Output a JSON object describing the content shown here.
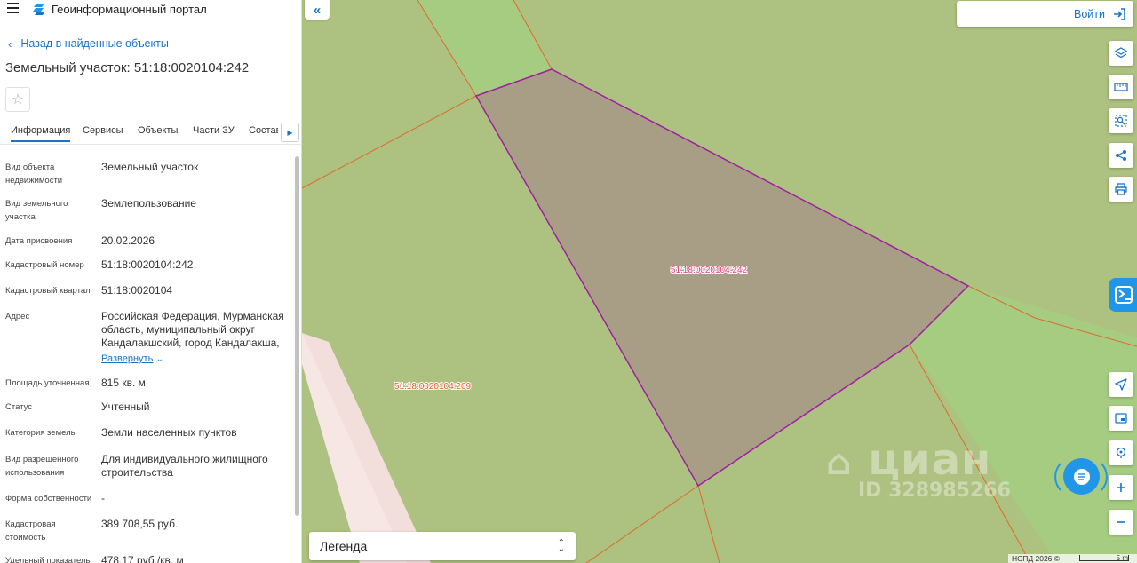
{
  "header": {
    "portal_title": "Геоинформационный портал",
    "login_label": "Войти"
  },
  "nav": {
    "back_label": "Назад в найденные объекты"
  },
  "object": {
    "title": "Земельный участок: 51:18:0020104:242"
  },
  "tabs": [
    {
      "label": "Информация",
      "active": true
    },
    {
      "label": "Сервисы"
    },
    {
      "label": "Объекты"
    },
    {
      "label": "Части ЗУ"
    },
    {
      "label": "Состав"
    }
  ],
  "properties": [
    {
      "label": "Вид объекта недвижимости",
      "value": "Земельный участок"
    },
    {
      "label": "Вид земельного участка",
      "value": "Землепользование"
    },
    {
      "label": "Дата присвоения",
      "value": "20.02.2026"
    },
    {
      "label": "Кадастровый номер",
      "value": "51:18:0020104:242"
    },
    {
      "label": "Кадастровый квартал",
      "value": "51:18:0020104"
    },
    {
      "label": "Адрес",
      "value": "Российская Федерация, Мурманская область, муниципальный округ Кандалакшский, город Кандалакша,",
      "expand_label": "Развернуть"
    },
    {
      "label": "Площадь уточненная",
      "value": "815 кв. м"
    },
    {
      "label": "Статус",
      "value": "Учтенный"
    },
    {
      "label": "Категория земель",
      "value": "Земли населенных пунктов"
    },
    {
      "label": "Вид разрешенного использования",
      "value": "Для индивидуального жилищного строительства"
    },
    {
      "label": "Форма собственности",
      "value": "-"
    },
    {
      "label": "Кадастровая стоимость",
      "value": "389 708,55 руб."
    },
    {
      "label": "Удельный показатель",
      "value": "478,17 руб./кв. м"
    }
  ],
  "map": {
    "parcel_selected_label": "51:18:0020104:242",
    "parcel_neighbor_label": "51:18:0020104:209",
    "legend_label": "Легенда",
    "attribution": "НСПД 2026 ©",
    "scale_label": "5 m",
    "watermark_brand": "циан",
    "watermark_id": "ID 328985266",
    "colors": {
      "land": "#adc180",
      "light_green": "#a6cc82",
      "parcel_fill": "#a79e85",
      "parcel_outline": "#a020a0",
      "boundary": "#e06a2a",
      "road": "#f6e6e4",
      "accent": "#1a73c9",
      "button_blue": "#2196e8"
    }
  },
  "tools": [
    {
      "name": "layers-icon"
    },
    {
      "name": "ruler-icon"
    },
    {
      "name": "search-area-icon"
    },
    {
      "name": "share-icon"
    },
    {
      "name": "print-icon"
    },
    {
      "name": "locate-icon"
    },
    {
      "name": "minimap-icon"
    },
    {
      "name": "geolocation-icon"
    },
    {
      "name": "zoom-in-icon"
    },
    {
      "name": "zoom-out-icon"
    }
  ]
}
